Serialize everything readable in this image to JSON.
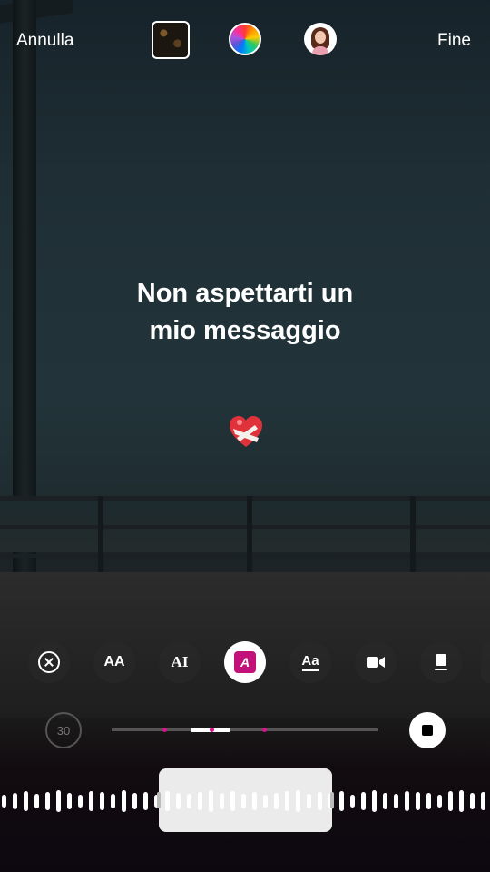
{
  "header": {
    "cancel_label": "Annulla",
    "done_label": "Fine"
  },
  "caption": {
    "line1": "Non aspettarti un",
    "line2": "mio messaggio"
  },
  "toolbar": {
    "font_size_icon": "AA",
    "text_style_icon": "AI",
    "animation_icon": "A",
    "text_bg_icon": "Aa",
    "active_tool": "animation"
  },
  "timeline": {
    "duration_label": "30",
    "selected_fraction_start": 0.3,
    "selected_fraction_end": 0.45
  },
  "colors": {
    "accent": "#d6168a",
    "animation_icon_bg": "#c2127a"
  },
  "icons": [
    "close-icon",
    "font-size-icon",
    "text-style-icon",
    "text-animation-icon",
    "text-background-icon",
    "video-icon",
    "sticker-icon",
    "stop-icon",
    "color-wheel-icon"
  ]
}
